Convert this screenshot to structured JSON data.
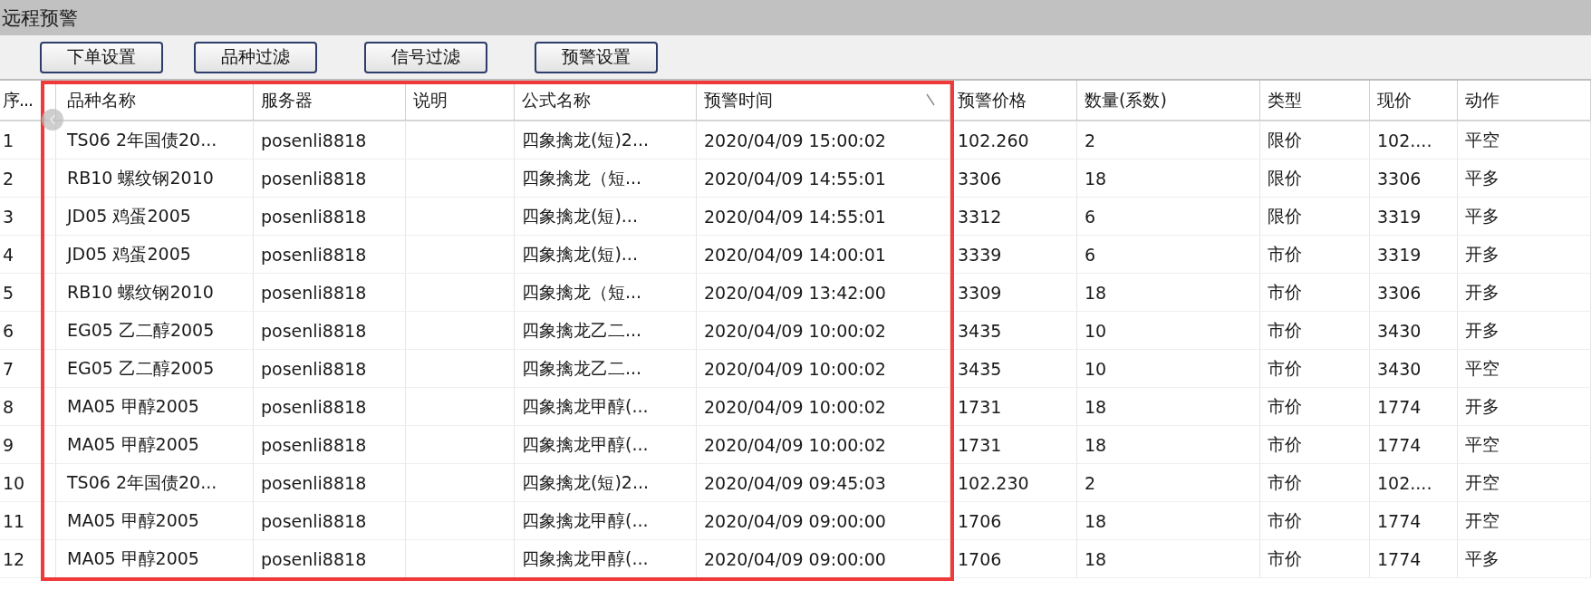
{
  "window": {
    "title": "远程预警"
  },
  "toolbar": {
    "buttons": [
      "下单设置",
      "品种过滤",
      "信号过滤",
      "预警设置"
    ]
  },
  "table": {
    "columns": [
      "序...",
      "品种名称",
      "服务器",
      "说明",
      "公式名称",
      "预警时间",
      "预警价格",
      "数量(系数)",
      "类型",
      "现价",
      "动作"
    ],
    "rows": [
      [
        "1",
        "TS06 2年国债20...",
        "posenli8818",
        "",
        "四象擒龙(短)2...",
        "2020/04/09 15:00:02",
        "102.260",
        "2",
        "限价",
        "102....",
        "平空"
      ],
      [
        "2",
        "RB10 螺纹钢2010",
        "posenli8818",
        "",
        "四象擒龙（短...",
        "2020/04/09 14:55:01",
        "3306",
        "18",
        "限价",
        "3306",
        "平多"
      ],
      [
        "3",
        "JD05 鸡蛋2005",
        "posenli8818",
        "",
        "四象擒龙(短)...",
        "2020/04/09 14:55:01",
        "3312",
        "6",
        "限价",
        "3319",
        "平多"
      ],
      [
        "4",
        "JD05 鸡蛋2005",
        "posenli8818",
        "",
        "四象擒龙(短)...",
        "2020/04/09 14:00:01",
        "3339",
        "6",
        "市价",
        "3319",
        "开多"
      ],
      [
        "5",
        "RB10 螺纹钢2010",
        "posenli8818",
        "",
        "四象擒龙（短...",
        "2020/04/09 13:42:00",
        "3309",
        "18",
        "市价",
        "3306",
        "开多"
      ],
      [
        "6",
        "EG05 乙二醇2005",
        "posenli8818",
        "",
        "四象擒龙乙二...",
        "2020/04/09 10:00:02",
        "3435",
        "10",
        "市价",
        "3430",
        "开多"
      ],
      [
        "7",
        "EG05 乙二醇2005",
        "posenli8818",
        "",
        "四象擒龙乙二...",
        "2020/04/09 10:00:02",
        "3435",
        "10",
        "市价",
        "3430",
        "平空"
      ],
      [
        "8",
        "MA05 甲醇2005",
        "posenli8818",
        "",
        "四象擒龙甲醇(...",
        "2020/04/09 10:00:02",
        "1731",
        "18",
        "市价",
        "1774",
        "开多"
      ],
      [
        "9",
        "MA05 甲醇2005",
        "posenli8818",
        "",
        "四象擒龙甲醇(...",
        "2020/04/09 10:00:02",
        "1731",
        "18",
        "市价",
        "1774",
        "平空"
      ],
      [
        "10",
        "TS06 2年国债20...",
        "posenli8818",
        "",
        "四象擒龙(短)2...",
        "2020/04/09 09:45:03",
        "102.230",
        "2",
        "市价",
        "102....",
        "开空"
      ],
      [
        "11",
        "MA05 甲醇2005",
        "posenli8818",
        "",
        "四象擒龙甲醇(...",
        "2020/04/09 09:00:00",
        "1706",
        "18",
        "市价",
        "1774",
        "开空"
      ],
      [
        "12",
        "MA05 甲醇2005",
        "posenli8818",
        "",
        "四象擒龙甲醇(...",
        "2020/04/09 09:00:00",
        "1706",
        "18",
        "市价",
        "1774",
        "平多"
      ]
    ]
  }
}
